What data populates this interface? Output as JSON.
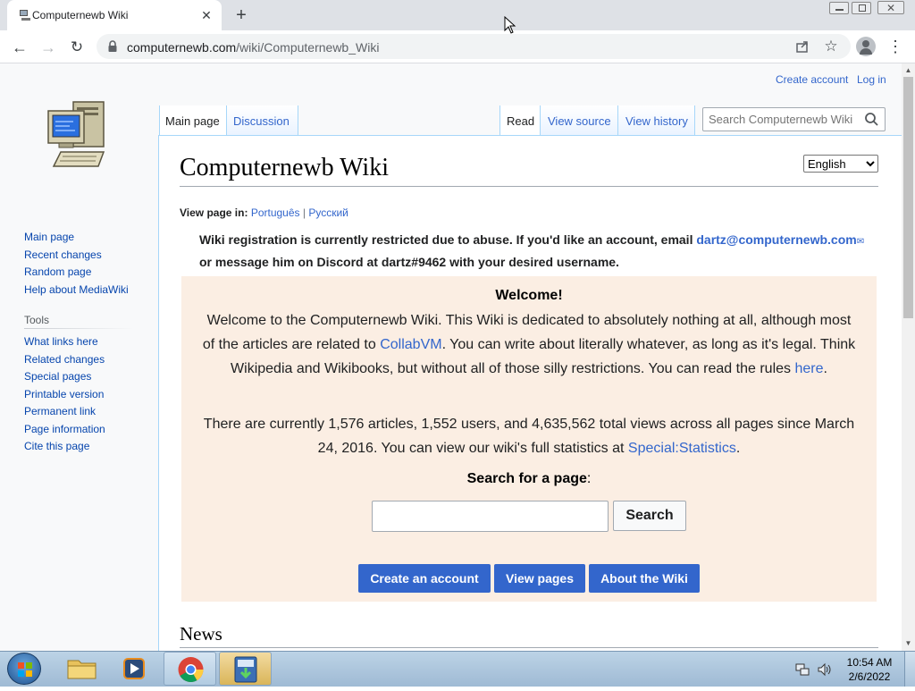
{
  "browser": {
    "tab_title": "Computernewb Wiki",
    "url_host": "computernewb.com",
    "url_path": "/wiki/Computernewb_Wiki"
  },
  "header": {
    "create_account": "Create account",
    "log_in": "Log in",
    "search_placeholder": "Search Computernewb Wiki"
  },
  "tabs": {
    "main_page": "Main page",
    "discussion": "Discussion",
    "read": "Read",
    "view_source": "View source",
    "view_history": "View history"
  },
  "sidebar": {
    "nav": [
      "Main page",
      "Recent changes",
      "Random page",
      "Help about MediaWiki"
    ],
    "tools_heading": "Tools",
    "tools": [
      "What links here",
      "Related changes",
      "Special pages",
      "Printable version",
      "Permanent link",
      "Page information",
      "Cite this page"
    ]
  },
  "article": {
    "title": "Computernewb Wiki",
    "language_selected": "English",
    "view_in_label": "View page in:",
    "langs": [
      "Português",
      "Русский"
    ],
    "lang_sep": "|",
    "notice_1": "Wiki registration is currently restricted due to abuse. If you'd like an account, email",
    "notice_email": "dartz@computernewb.com",
    "notice_2": "or message him on Discord at dartz#9462 with your desired username.",
    "welcome_heading": "Welcome!",
    "welcome_p1a": "Welcome to the Computernewb Wiki. This Wiki is dedicated to absolutely nothing at all, although most of the articles are related to",
    "welcome_link1": "CollabVM",
    "welcome_p1b": ". You can write about literally whatever, as long as it's legal. Think Wikipedia and Wikibooks, but without all of those silly restrictions. You can read the rules",
    "welcome_link2": "here",
    "welcome_p1c": ".",
    "stats_a": "There are currently 1,576 articles, 1,552 users, and 4,635,562 total views across all pages since March 24, 2016. You can view our wiki's full statistics at",
    "stats_link": "Special:Statistics",
    "stats_b": ".",
    "search_label": "Search for a page",
    "search_colon": ":",
    "search_button": "Search",
    "cta_create": "Create an account",
    "cta_pages": "View pages",
    "cta_about": "About the Wiki",
    "news_heading": "News"
  },
  "taskbar": {
    "time": "10:54 AM",
    "date": "2/6/2022"
  }
}
